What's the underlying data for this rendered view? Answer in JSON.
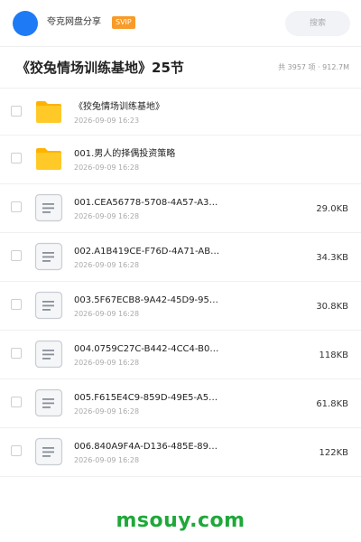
{
  "header": {
    "sharer_name": "夸克网盘分享",
    "badge": "SVIP",
    "search_placeholder": "搜索"
  },
  "title_row": {
    "title": "《狡兔情场训练基地》25节",
    "meta": "共 3957 项 · 912.7M"
  },
  "files": [
    {
      "type": "folder",
      "name": "《狡兔情场训练基地》",
      "date": "2026-09-09 16:23",
      "size": ""
    },
    {
      "type": "folder",
      "name": "001.男人的择偶投资策略",
      "date": "2026-09-09 16:28",
      "size": ""
    },
    {
      "type": "file",
      "name": "001.CEA56778-5708-4A57-A3…",
      "date": "2026-09-09 16:28",
      "size": "29.0KB"
    },
    {
      "type": "file",
      "name": "002.A1B419CE-F76D-4A71-AB…",
      "date": "2026-09-09 16:28",
      "size": "34.3KB"
    },
    {
      "type": "file",
      "name": "003.5F67ECB8-9A42-45D9-95…",
      "date": "2026-09-09 16:28",
      "size": "30.8KB"
    },
    {
      "type": "file",
      "name": "004.0759C27C-B442-4CC4-B0…",
      "date": "2026-09-09 16:28",
      "size": "118KB"
    },
    {
      "type": "file",
      "name": "005.F615E4C9-859D-49E5-A5…",
      "date": "2026-09-09 16:28",
      "size": "61.8KB"
    },
    {
      "type": "file",
      "name": "006.840A9F4A-D136-485E-89…",
      "date": "2026-09-09 16:28",
      "size": "122KB"
    }
  ],
  "watermark": "msouy.com",
  "colors": {
    "accent_blue": "#1e7bf5",
    "svip_orange": "#f89b28",
    "folder_yellow": "#ffc107",
    "watermark_green": "#1fa83a"
  }
}
